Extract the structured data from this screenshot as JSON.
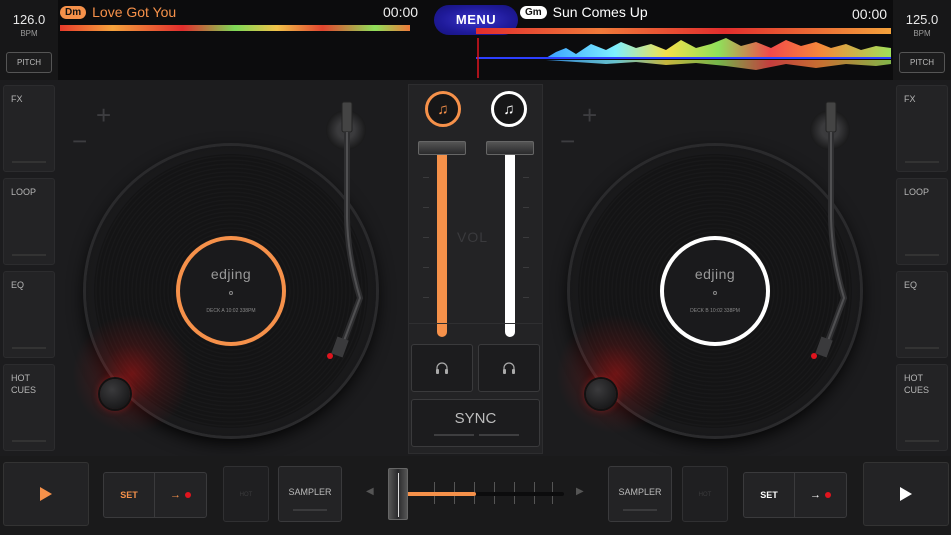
{
  "colors": {
    "deck_a": "#f6914a",
    "deck_b": "#ffffff",
    "menu": "#2b26b0",
    "record_glow": "#e0141e"
  },
  "deck_a": {
    "bpm": "126.0",
    "bpm_unit": "BPM",
    "pitch_label": "PITCH",
    "key": "Dm",
    "title": "Love Got You",
    "time": "00:00",
    "label_logo": "edjing",
    "label_text": "DECK A 10:02 338PM",
    "play_icon": "play-icon",
    "set_label": "SET",
    "rec_arrow": "→",
    "hot_label": "HOT",
    "sampler_label": "SAMPLER"
  },
  "deck_b": {
    "bpm": "125.0",
    "bpm_unit": "BPM",
    "pitch_label": "PITCH",
    "key": "Gm",
    "title": "Sun Comes Up",
    "time": "00:00",
    "label_logo": "edjing",
    "label_text": "DECK B 10:02 338PM",
    "play_icon": "play-icon",
    "set_label": "SET",
    "rec_arrow": "→",
    "hot_label": "HOT",
    "sampler_label": "SAMPLER"
  },
  "menu_label": "MENU",
  "side_panel": {
    "fx": "FX",
    "loop": "LOOP",
    "eq": "EQ",
    "hot_cues": "HOT\nCUES"
  },
  "mixer": {
    "vol_label": "VOL",
    "sync_label": "SYNC",
    "channel_icon": "music-note-icon",
    "headphone_icon": "headphones-icon"
  },
  "zoom": {
    "plus": "+",
    "minus": "−"
  }
}
